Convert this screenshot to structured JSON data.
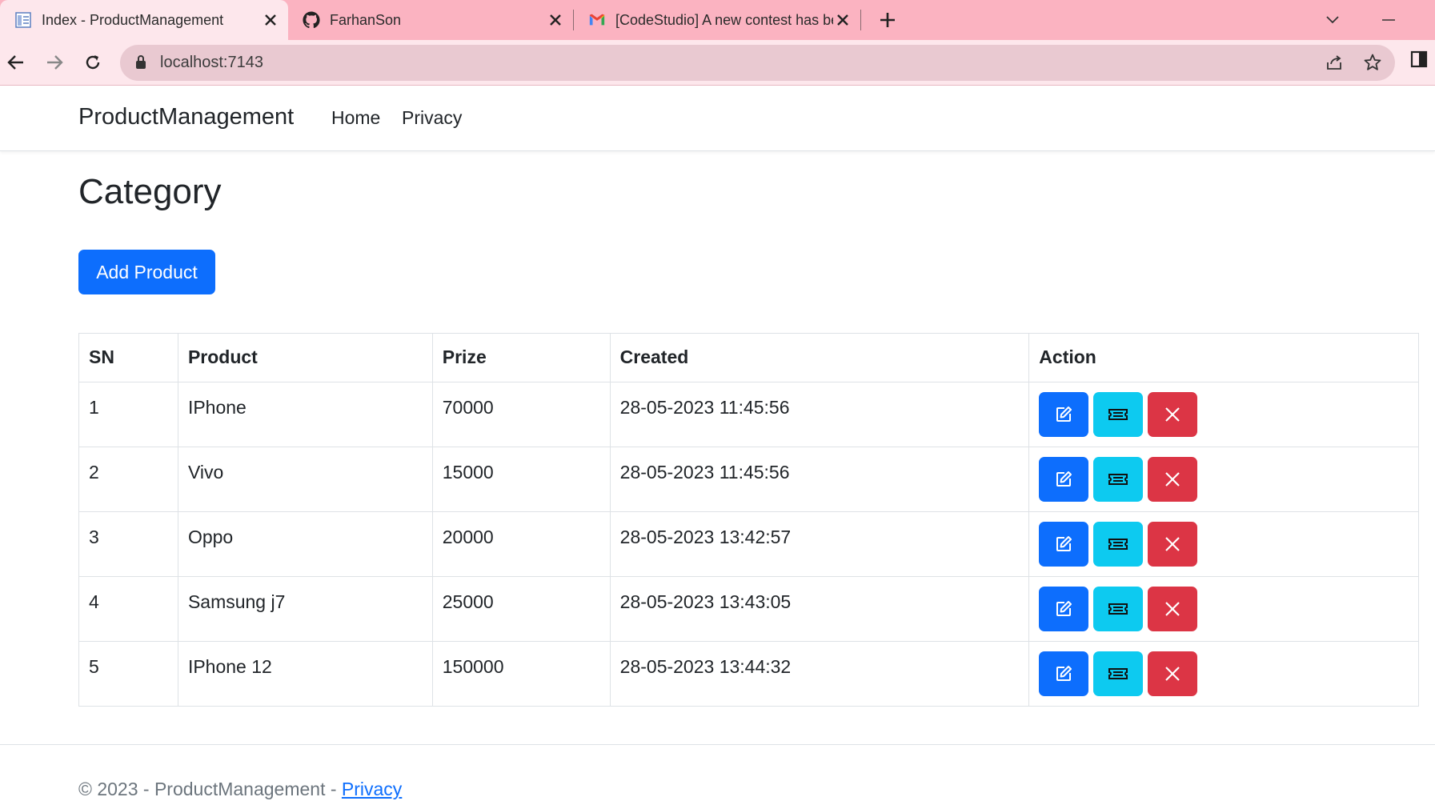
{
  "browser": {
    "tabs": [
      {
        "title": "Index - ProductManagement",
        "icon": "page-icon",
        "active": true
      },
      {
        "title": "FarhanSon",
        "icon": "github-icon",
        "active": false
      },
      {
        "title": "[CodeStudio] A new contest has be",
        "icon": "gmail-icon",
        "active": false
      }
    ],
    "url": "localhost:7143"
  },
  "navbar": {
    "brand": "ProductManagement",
    "links": [
      "Home",
      "Privacy"
    ]
  },
  "main": {
    "heading": "Category",
    "add_button": "Add Product",
    "table": {
      "headers": [
        "SN",
        "Product",
        "Prize",
        "Created",
        "Action"
      ],
      "rows": [
        [
          "1",
          "IPhone",
          "70000",
          "28-05-2023 11:45:56"
        ],
        [
          "2",
          "Vivo",
          "15000",
          "28-05-2023 11:45:56"
        ],
        [
          "3",
          "Oppo",
          "20000",
          "28-05-2023 13:42:57"
        ],
        [
          "4",
          "Samsung j7",
          "25000",
          "28-05-2023 13:43:05"
        ],
        [
          "5",
          "IPhone 12",
          "150000",
          "28-05-2023 13:44:32"
        ]
      ],
      "action_icons": [
        "edit-icon",
        "details-icon",
        "delete-icon"
      ]
    }
  },
  "footer": {
    "text": "© 2023 - ProductManagement - ",
    "link": "Privacy"
  },
  "colors": {
    "primary": "#0d6efd",
    "info": "#0dcaf0",
    "danger": "#dc3545",
    "tabbar": "#fbb3c1"
  }
}
